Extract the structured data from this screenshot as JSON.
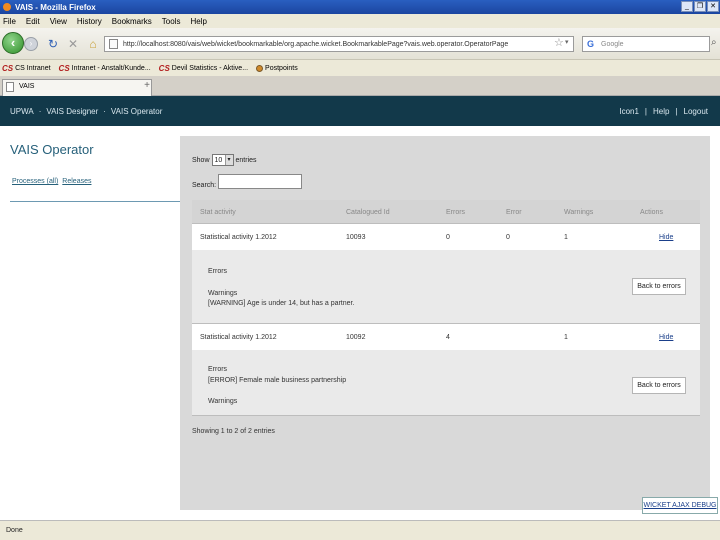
{
  "window": {
    "title": "VAIS - Mozilla Firefox",
    "buttons": [
      "_",
      "❐",
      "✕"
    ]
  },
  "menu": [
    "File",
    "Edit",
    "View",
    "History",
    "Bookmarks",
    "Tools",
    "Help"
  ],
  "nav": {
    "url": "http://localhost:8080/vais/web/wicket/bookmarkable/org.apache.wicket.BookmarkablePage?vais.web.operator.OperatorPage",
    "search_placeholder": "Google"
  },
  "bookmarks": [
    {
      "icon": "CS",
      "label": "CS Intranet"
    },
    {
      "icon": "CS",
      "label": "Intranet - Anstalt/Kunde..."
    },
    {
      "icon": "CS",
      "label": "Devil Statistics - Aktive..."
    },
    {
      "icon": "ff",
      "label": "Postpoints"
    }
  ],
  "tab": {
    "title": "VAIS"
  },
  "app": {
    "nav": [
      "UPWA",
      "VAIS Designer",
      "VAIS Operator"
    ],
    "right": [
      "Icon1",
      "Help",
      "Logout"
    ]
  },
  "sidebar": {
    "title": "VAIS Operator",
    "links": [
      "Processes (all)",
      "Releases"
    ]
  },
  "table_controls": {
    "show_label": "Show",
    "length_value": "10",
    "entries_label": "entries",
    "search_label": "Search:"
  },
  "table": {
    "headers": [
      "Stat activity",
      "Catalogued Id",
      "Errors",
      "Error",
      "Warnings",
      "Actions"
    ],
    "rows": [
      {
        "activity": "Statistical activity 1.2012",
        "catalogue_id": "10093",
        "errors": "0",
        "error": "0",
        "warnings": "1",
        "action": "Hide",
        "detail_errors_label": "Errors",
        "detail_errors_text": "",
        "detail_warnings_label": "Warnings",
        "detail_warnings_text": "[WARNING] Age is under 14, but has a partner.",
        "back_label": "Back to errors"
      },
      {
        "activity": "Statistical activity 1.2012",
        "catalogue_id": "10092",
        "errors": "4",
        "error": "",
        "warnings": "1",
        "action": "Hide",
        "detail_errors_label": "Errors",
        "detail_errors_text": "[ERROR] Female male business partnership",
        "detail_warnings_label": "Warnings",
        "detail_warnings_text": "",
        "back_label": "Back to errors"
      }
    ]
  },
  "info": "Showing 1 to 2 of 2 entries",
  "debug_button": "WICKET AJAX DEBUG",
  "status": "Done"
}
